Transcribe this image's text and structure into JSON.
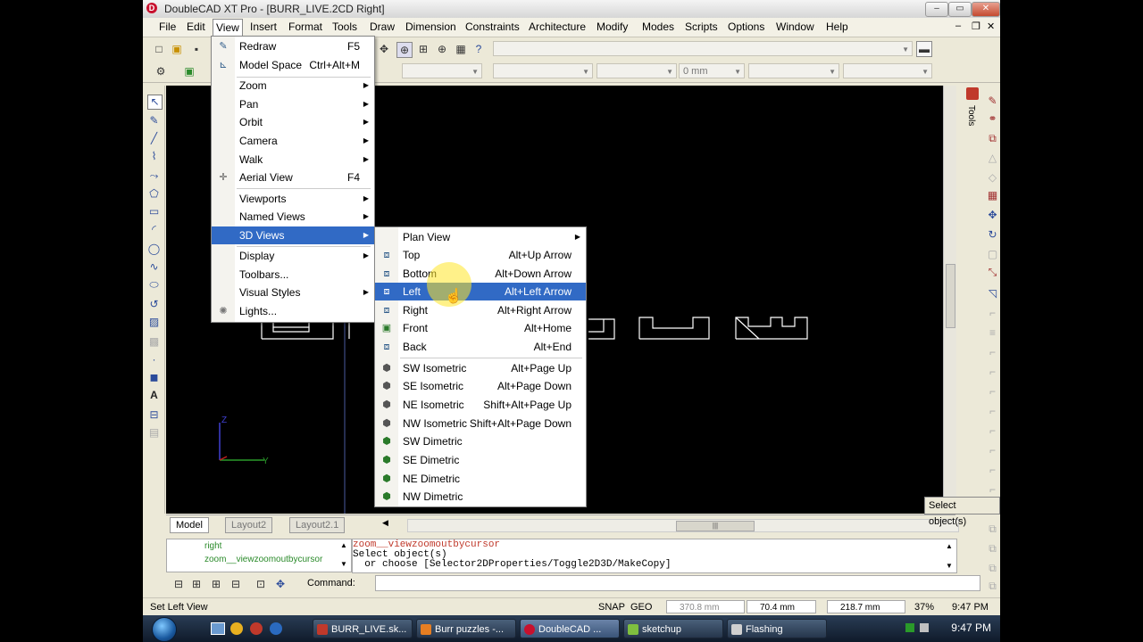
{
  "window": {
    "title": "DoubleCAD XT Pro - [BURR_LIVE.2CD Right]",
    "minimize": "–",
    "restore": "▭",
    "close": "✕"
  },
  "menubar": [
    "File",
    "Edit",
    "View",
    "Insert",
    "Format",
    "Tools",
    "Draw",
    "Dimension",
    "Constraints",
    "Architecture",
    "Modify",
    "Modes",
    "Scripts",
    "Options",
    "Window",
    "Help"
  ],
  "toolbar": {
    "dim_value": "0 mm"
  },
  "view_menu": [
    {
      "label": "Redraw",
      "shortcut": "F5",
      "icon": "redraw-icon"
    },
    {
      "label": "Model Space",
      "shortcut": "Ctrl+Alt+M",
      "icon": "model-space-icon"
    },
    {
      "label": "Zoom",
      "submenu": true
    },
    {
      "label": "Pan",
      "submenu": true
    },
    {
      "label": "Orbit",
      "submenu": true
    },
    {
      "label": "Camera",
      "submenu": true
    },
    {
      "label": "Walk",
      "submenu": true
    },
    {
      "label": "Aerial View",
      "shortcut": "F4",
      "icon": "aerial-view-icon"
    },
    {
      "label": "Viewports",
      "submenu": true
    },
    {
      "label": "Named Views",
      "submenu": true
    },
    {
      "label": "3D Views",
      "submenu": true,
      "highlight": true
    },
    {
      "label": "Display",
      "submenu": true
    },
    {
      "label": "Toolbars..."
    },
    {
      "label": "Visual Styles",
      "submenu": true
    },
    {
      "label": "Lights...",
      "icon": "lights-icon"
    }
  ],
  "views_submenu": [
    {
      "label": "Plan View",
      "submenu": true
    },
    {
      "label": "Top",
      "shortcut": "Alt+Up Arrow"
    },
    {
      "label": "Bottom",
      "shortcut": "Alt+Down Arrow"
    },
    {
      "label": "Left",
      "shortcut": "Alt+Left Arrow",
      "highlight": true
    },
    {
      "label": "Right",
      "shortcut": "Alt+Right Arrow"
    },
    {
      "label": "Front",
      "shortcut": "Alt+Home"
    },
    {
      "label": "Back",
      "shortcut": "Alt+End"
    },
    {
      "label": "SW Isometric",
      "shortcut": "Alt+Page Up"
    },
    {
      "label": "SE Isometric",
      "shortcut": "Alt+Page Down"
    },
    {
      "label": "NE Isometric",
      "shortcut": "Shift+Alt+Page Up"
    },
    {
      "label": "NW Isometric",
      "shortcut": "Shift+Alt+Page Down"
    },
    {
      "label": "SW Dimetric"
    },
    {
      "label": "SE Dimetric"
    },
    {
      "label": "NE Dimetric"
    },
    {
      "label": "NW Dimetric"
    }
  ],
  "tooltip": "Select object(s)",
  "axes": {
    "z": "Z",
    "y": "Y"
  },
  "tabs": [
    "Model",
    "Layout2",
    "Layout2.1"
  ],
  "history": [
    "right",
    "zoom__viewzoomoutbycursor"
  ],
  "command_output": [
    "zoom__viewzoomoutbycursor",
    "Select object(s)",
    "  or choose [Selector2DProperties/Toggle2D3D/MakeCopy]"
  ],
  "command_label": "Command:",
  "right_panel_label": "Tools",
  "status": {
    "message": "Set Left View",
    "snap": "SNAP",
    "geo": "GEO",
    "x": "370.8 mm",
    "y": "70.4 mm",
    "z": "218.7 mm",
    "zoom": "37%",
    "time": "9:47 PM"
  },
  "taskbar": {
    "tasks": [
      {
        "label": "BURR_LIVE.sk...",
        "color": "#c0392b"
      },
      {
        "label": "Burr puzzles -...",
        "color": "#e67e22"
      },
      {
        "label": "DoubleCAD ...",
        "color": "#c8102e",
        "active": true
      },
      {
        "label": "sketchup",
        "color": "#7fbf3f"
      },
      {
        "label": "Flashing",
        "color": "#d0d0d0"
      }
    ],
    "clock": "9:47 PM"
  }
}
